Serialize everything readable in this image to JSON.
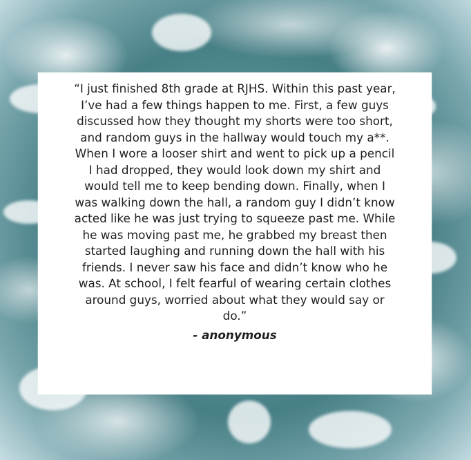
{
  "quote_lines": [
    "“I just finished 8th grade at RJHS. Within this past year,",
    "I’ve had a few things happen to me. First, a few guys",
    "discussed how they thought my shorts were too short,",
    "and random guys in the hallway would touch my a**.",
    "When I wore a looser shirt and went to pick up a pencil",
    "I had dropped, they would look down my shirt and",
    "would tell me to keep bending down. Finally, when I",
    "was walking down the hall, a random guy I didn’t know",
    "acted like he was just trying to squeeze past me. While",
    "he was moving past me, he grabbed my breast then",
    "started laughing and running down the hall with his",
    "friends. I never saw his face and didn’t know who he",
    "was. At school, I felt fearful of wearing certain clothes",
    "around guys, worried about what they would say or",
    "do.”"
  ],
  "author": "- anonymous"
}
